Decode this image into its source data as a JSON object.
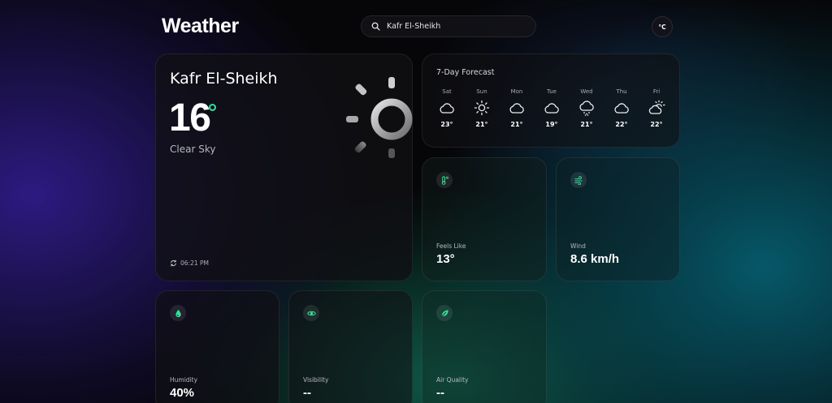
{
  "app": {
    "title": "Weather"
  },
  "search": {
    "value": "Kafr El-Sheikh",
    "placeholder": ""
  },
  "unit_toggle": {
    "label": "°C"
  },
  "current": {
    "city": "Kafr El-Sheikh",
    "temp": "16",
    "condition": "Clear Sky",
    "updated": "06:21 PM",
    "icon": "sun-icon"
  },
  "forecast": {
    "title": "7-Day Forecast",
    "days": [
      {
        "name": "Sat",
        "temp": "23°",
        "icon": "cloud-icon"
      },
      {
        "name": "Sun",
        "temp": "21°",
        "icon": "sun-icon"
      },
      {
        "name": "Mon",
        "temp": "21°",
        "icon": "cloud-icon"
      },
      {
        "name": "Tue",
        "temp": "19°",
        "icon": "cloud-icon"
      },
      {
        "name": "Wed",
        "temp": "21°",
        "icon": "snow-cloud-icon"
      },
      {
        "name": "Thu",
        "temp": "22°",
        "icon": "cloud-icon"
      },
      {
        "name": "Fri",
        "temp": "22°",
        "icon": "partly-cloudy-icon"
      }
    ]
  },
  "stats": {
    "feels_like": {
      "label": "Feels Like",
      "value": "13°",
      "icon": "thermometer-icon"
    },
    "wind": {
      "label": "Wind",
      "value": "8.6 km/h",
      "icon": "wind-icon"
    },
    "humidity": {
      "label": "Humidity",
      "value": "40%",
      "icon": "droplet-icon"
    },
    "visibility": {
      "label": "Visibility",
      "value": "--",
      "icon": "eye-icon"
    },
    "air_quality": {
      "label": "Air Quality",
      "value": "--",
      "icon": "leaf-icon"
    }
  },
  "colors": {
    "accent": "#2fe29a",
    "text_muted": "#b7b7bd"
  }
}
